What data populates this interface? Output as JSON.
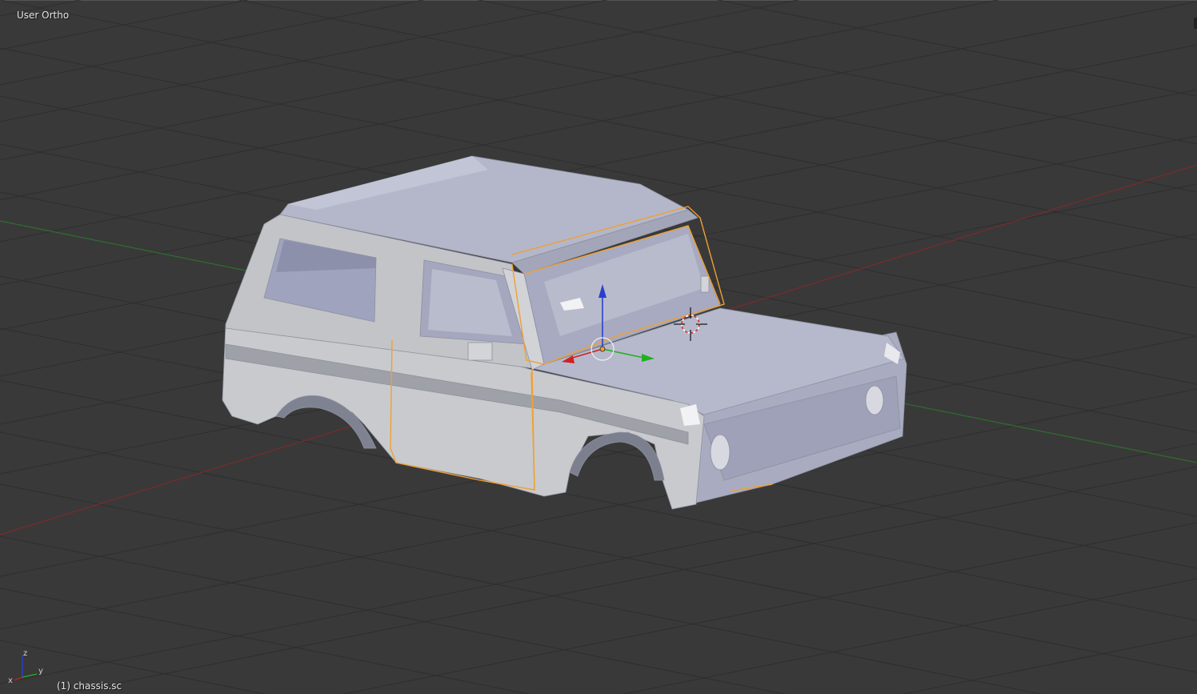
{
  "viewport": {
    "view_label": "User Ortho",
    "object_label": "(1) chassis.sc",
    "axis_letters": {
      "x": "x",
      "y": "y",
      "z": "z"
    },
    "colors": {
      "background": "#393939",
      "grid": "#2f2f2f",
      "x_axis": "#8a2a2a",
      "y_axis": "#2f7a2f",
      "selection": "#f0a030",
      "mesh": "#b8bccd"
    },
    "object": {
      "name": "chassis.sc",
      "selected": true
    },
    "icons": [
      "3d-cursor-icon",
      "transform-manipulator-icon",
      "axis-orientation-icon"
    ]
  }
}
